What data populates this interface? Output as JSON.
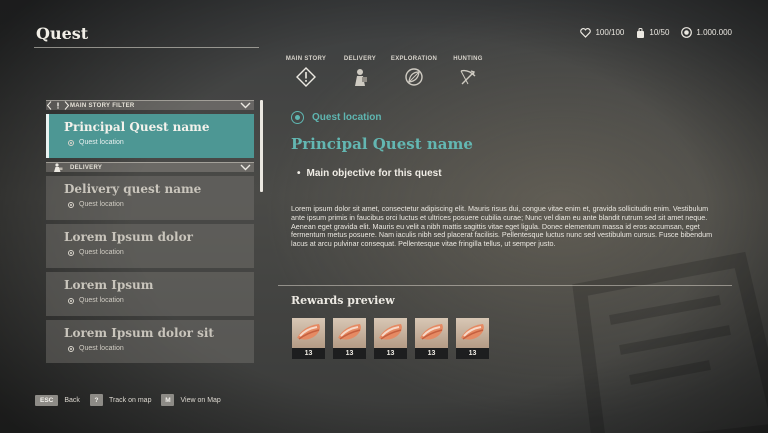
{
  "header": {
    "title": "Quest",
    "stats": [
      {
        "icon": "heart-icon",
        "value": "100/100"
      },
      {
        "icon": "backpack-icon",
        "value": "10/50"
      },
      {
        "icon": "coin-icon",
        "value": "1.000.000"
      }
    ]
  },
  "tabs": [
    {
      "label": "MAIN STORY",
      "icon": "exclamation-diamond-icon",
      "active": true
    },
    {
      "label": "DELIVERY",
      "icon": "courier-icon",
      "active": false
    },
    {
      "label": "EXPLORATION",
      "icon": "leaf-compass-icon",
      "active": false
    },
    {
      "label": "HUNTING",
      "icon": "crossbow-icon",
      "active": false
    }
  ],
  "quest_list": {
    "main_filter_label": "MAIN STORY FILTER",
    "delivery_filter_label": "DELIVERY",
    "selected": {
      "name": "Principal Quest name",
      "location": "Quest location"
    },
    "items": [
      {
        "name": "Delivery quest name",
        "location": "Quest location"
      },
      {
        "name": "Lorem Ipsum dolor",
        "location": "Quest location"
      },
      {
        "name": "Lorem Ipsum",
        "location": "Quest location"
      },
      {
        "name": "Lorem Ipsum dolor sit",
        "location": "Quest location"
      }
    ]
  },
  "detail": {
    "location": "Quest location",
    "title": "Principal Quest name",
    "objective": "Main objective for this quest",
    "description": "Lorem ipsum dolor sit amet, consectetur adipiscing elit. Mauris risus dui, congue vitae enim et, gravida sollicitudin enim. Vestibulum ante ipsum primis in faucibus orci luctus et ultrices posuere cubilia curae; Nunc vel diam eu ante blandit rutrum sed sit amet neque. Aenean eget gravida elit. Mauris eu velit a nibh mattis sagittis vitae eget ligula. Donec elementum massa id eros accumsan, eget fermentum metus posuere. Nam iaculis nibh sed placerat facilisis. Pellentesque luctus nunc sed vestibulum cursus. Fusce bibendum lacus at arcu pulvinar consequat. Pellentesque vitae fringilla tellus, ut semper justo.",
    "rewards_title": "Rewards preview",
    "rewards": [
      {
        "icon": "meat-icon",
        "count": "13"
      },
      {
        "icon": "meat-icon",
        "count": "13"
      },
      {
        "icon": "meat-icon",
        "count": "13"
      },
      {
        "icon": "meat-icon",
        "count": "13"
      },
      {
        "icon": "meat-icon",
        "count": "13"
      }
    ]
  },
  "footer": {
    "hints": [
      {
        "key": "ESC",
        "label": "Back"
      },
      {
        "key": "?",
        "label": "Track on map"
      },
      {
        "key": "M",
        "label": "View on Map"
      }
    ]
  },
  "colors": {
    "accent": "#63b7b2",
    "selected_bg": "#4d9794",
    "background": "#434442"
  }
}
